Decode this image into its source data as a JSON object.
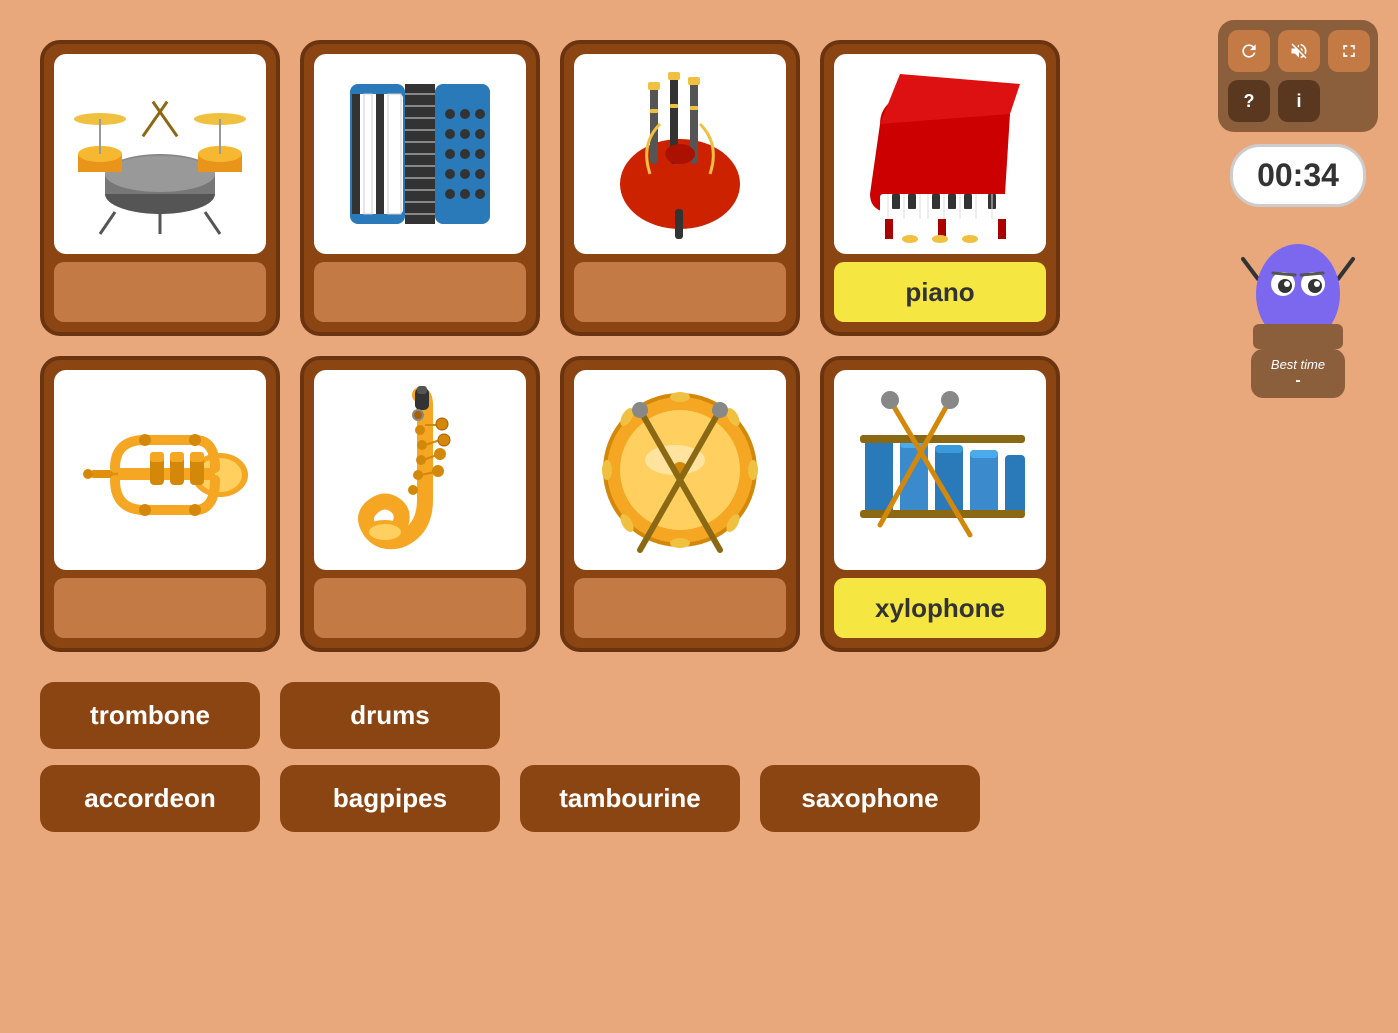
{
  "timer": {
    "display": "00:34"
  },
  "best_time": {
    "label": "Best time",
    "value": "-"
  },
  "cards": [
    {
      "id": "drums",
      "instrument": "drums",
      "label": "",
      "label_filled": false
    },
    {
      "id": "accordeon",
      "instrument": "accordeon",
      "label": "",
      "label_filled": false
    },
    {
      "id": "bagpipes",
      "instrument": "bagpipes",
      "label": "",
      "label_filled": false
    },
    {
      "id": "piano",
      "instrument": "piano",
      "label": "piano",
      "label_filled": true
    },
    {
      "id": "trumpet",
      "instrument": "trumpet",
      "label": "",
      "label_filled": false
    },
    {
      "id": "saxophone",
      "instrument": "saxophone",
      "label": "",
      "label_filled": false
    },
    {
      "id": "tambourine",
      "instrument": "tambourine",
      "label": "",
      "label_filled": false
    },
    {
      "id": "xylophone",
      "instrument": "xylophone",
      "label": "xylophone",
      "label_filled": true
    }
  ],
  "word_buttons_row1": [
    {
      "id": "trombone",
      "label": "trombone"
    },
    {
      "id": "drums",
      "label": "drums"
    }
  ],
  "word_buttons_row2": [
    {
      "id": "accordeon",
      "label": "accordeon"
    },
    {
      "id": "bagpipes",
      "label": "bagpipes"
    },
    {
      "id": "tambourine",
      "label": "tambourine"
    },
    {
      "id": "saxophone",
      "label": "saxophone"
    }
  ],
  "controls": {
    "restart_label": "↺",
    "mute_label": "🔇",
    "fullscreen_label": "⛶",
    "help_label": "?",
    "info_label": "i"
  }
}
